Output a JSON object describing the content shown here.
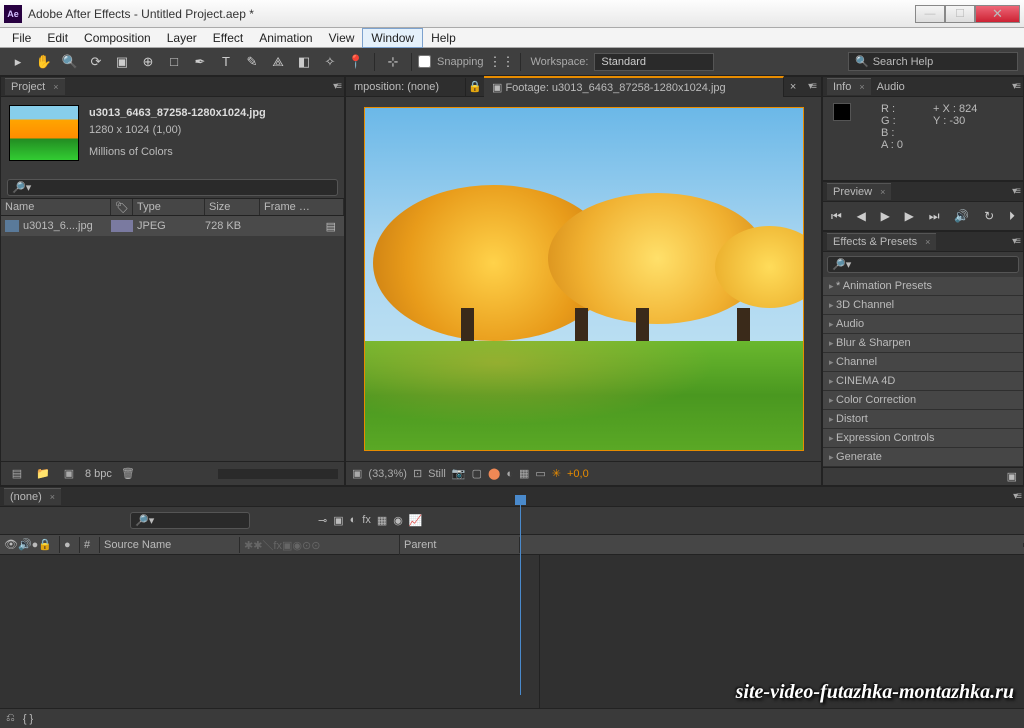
{
  "window": {
    "title": "Adobe After Effects - Untitled Project.aep *",
    "icon_label": "Ae"
  },
  "menu": {
    "items": [
      "File",
      "Edit",
      "Composition",
      "Layer",
      "Effect",
      "Animation",
      "View",
      "Window",
      "Help"
    ],
    "active": "Window"
  },
  "toolbar": {
    "snapping": "Snapping",
    "workspace_label": "Workspace:",
    "workspace_value": "Standard",
    "search_placeholder": "Search Help"
  },
  "project": {
    "tab": "Project",
    "file": {
      "name": "u3013_6463_87258-1280x1024.jpg",
      "name_short": "u3013_6....jpg",
      "dims": "1280 x 1024 (1,00)",
      "colors": "Millions of Colors",
      "type": "JPEG",
      "size": "728 KB"
    },
    "columns": {
      "name": "Name",
      "type": "Type",
      "size": "Size",
      "frame": "Frame …"
    },
    "footer": {
      "bpc": "8 bpc"
    }
  },
  "composition": {
    "tab_none": "mposition: (none)",
    "tab_footage": "Footage: u3013_6463_87258-1280x1024.jpg",
    "zoom": "(33,3%)",
    "still": "Still",
    "exposure": "+0,0"
  },
  "info": {
    "tab1": "Info",
    "tab2": "Audio",
    "r": "R :",
    "g": "G :",
    "b": "B :",
    "a": "A :  0",
    "x": "X :  824",
    "y": "Y :  -30"
  },
  "preview": {
    "tab": "Preview"
  },
  "effects": {
    "tab": "Effects & Presets",
    "items": [
      "* Animation Presets",
      "3D Channel",
      "Audio",
      "Blur & Sharpen",
      "Channel",
      "CINEMA 4D",
      "Color Correction",
      "Distort",
      "Expression Controls",
      "Generate"
    ]
  },
  "timeline": {
    "tab": "(none)",
    "cols": {
      "source": "Source Name",
      "parent": "Parent"
    },
    "toggle": "Toggle Switches / Modes"
  },
  "watermark": "site-video-futazhka-montazhka.ru"
}
